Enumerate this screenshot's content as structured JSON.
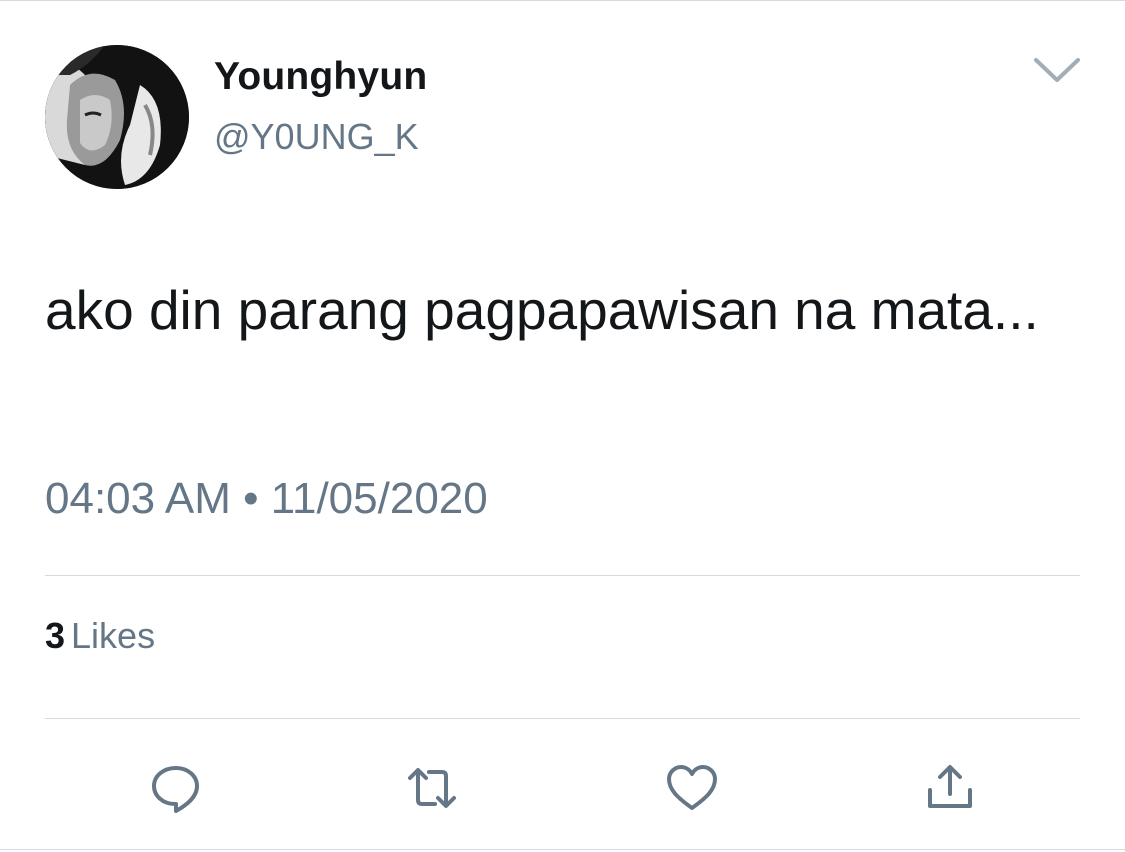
{
  "tweet": {
    "display_name": "Younghyun",
    "handle": "@Y0UNG_K",
    "text": "ako din parang pagpapawisan na mata...",
    "time": "04:03 AM",
    "separator": "•",
    "date": "11/05/2020",
    "likes_count": "3",
    "likes_label": "Likes"
  },
  "icons": {
    "menu": "chevron-down-icon",
    "reply": "reply-icon",
    "retweet": "retweet-icon",
    "like": "heart-icon",
    "share": "share-icon"
  },
  "colors": {
    "text": "#14171a",
    "secondary": "#657786",
    "icon": "#657786",
    "divider": "#d7dbdf"
  }
}
